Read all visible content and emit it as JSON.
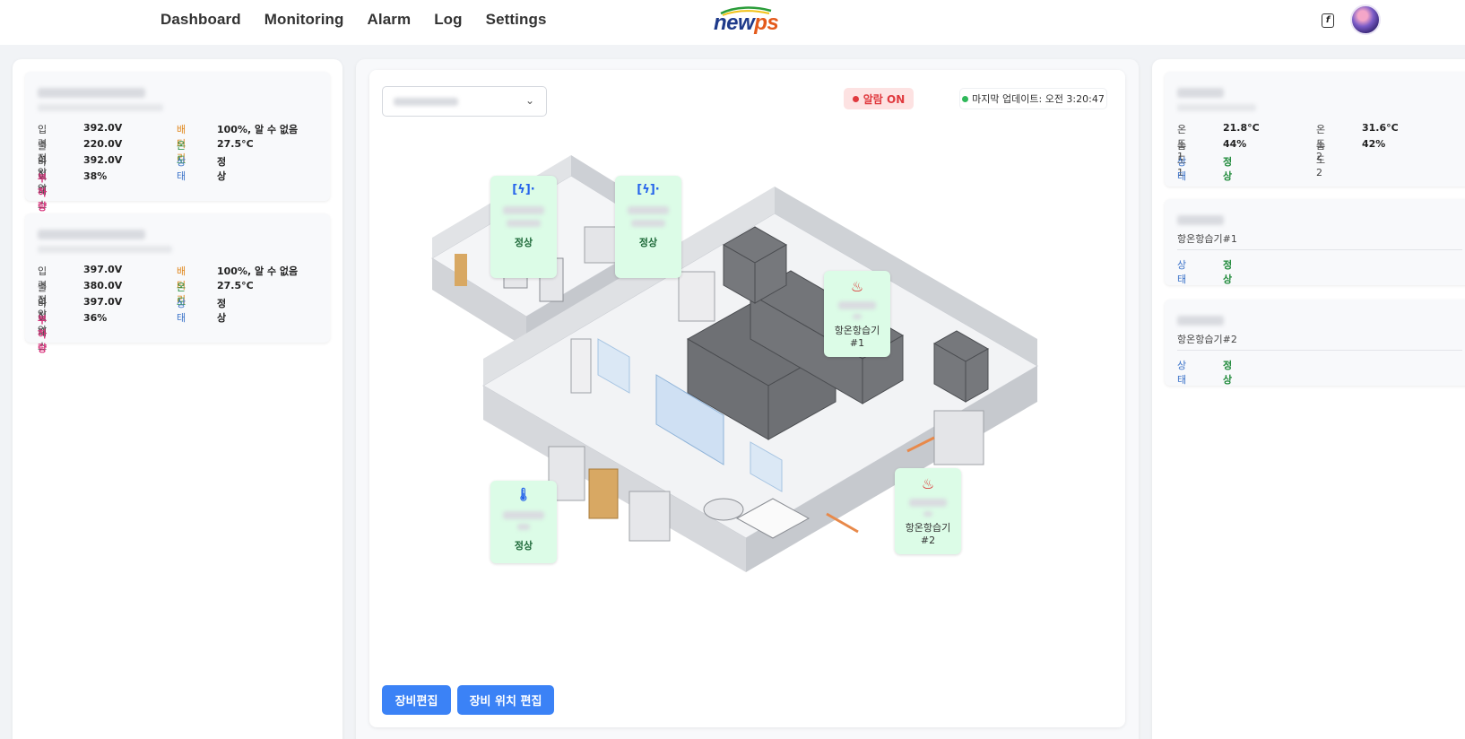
{
  "nav": {
    "items": [
      "Dashboard",
      "Monitoring",
      "Alarm",
      "Log",
      "Settings"
    ],
    "logo": "newps"
  },
  "ups_cards": [
    {
      "rows": [
        {
          "k": "입력전압",
          "v": "392.0V",
          "k2": "배터리",
          "v2": "100%, 알 수 없음"
        },
        {
          "k": "출력전압",
          "v": "220.0V",
          "k2": "온도",
          "v2": "27.5°C"
        },
        {
          "k": "바이패스",
          "v": "392.0V",
          "k2": "상태",
          "v2": "정상"
        },
        {
          "k": "부하량",
          "v": "38%"
        }
      ]
    },
    {
      "rows": [
        {
          "k": "입력전압",
          "v": "397.0V",
          "k2": "배터리",
          "v2": "100%, 알 수 없음"
        },
        {
          "k": "출력전압",
          "v": "380.0V",
          "k2": "온도",
          "v2": "27.5°C"
        },
        {
          "k": "바이패스",
          "v": "397.0V",
          "k2": "상태",
          "v2": "정상"
        },
        {
          "k": "부하량",
          "v": "36%"
        }
      ]
    }
  ],
  "main": {
    "alarm_badge": "알람 ON",
    "last_update": "마지막 업데이트: 오전 3:20:47",
    "select_chevron": "⌄",
    "tiles": [
      {
        "icon": "ups-icon",
        "glyph": "[ϟ]·",
        "status": "정상"
      },
      {
        "icon": "ups-icon",
        "glyph": "[ϟ]·",
        "status": "정상"
      },
      {
        "icon": "flame-icon",
        "glyph": "♨",
        "name": "항온항습기\n#1"
      },
      {
        "icon": "thermometer-icon",
        "glyph": "🌡",
        "status": "정상"
      },
      {
        "icon": "flame-icon",
        "glyph": "♨",
        "name": "항온항습기\n#2"
      }
    ],
    "buttons": {
      "edit_equipment": "장비편집",
      "edit_position": "장비 위치 편집"
    }
  },
  "right_cards": {
    "sensor": {
      "t1_label": "온도1",
      "t1": "21.8°C",
      "t2_label": "온도2",
      "t2": "31.6°C",
      "h1_label": "습도1",
      "h1": "44%",
      "h2_label": "습도2",
      "h2": "42%",
      "status_label": "상태",
      "status": "정상"
    },
    "hvac1": {
      "title": "항온항습기#1",
      "status_label": "상태",
      "status": "정상"
    },
    "hvac2": {
      "title": "항온항습기#2",
      "status_label": "상태",
      "status": "정상"
    }
  },
  "colors": {
    "accent": "#3b82f6",
    "ok": "#1f8a3a",
    "alarm": "#e0393e",
    "tile_bg": "#dcfce7"
  }
}
